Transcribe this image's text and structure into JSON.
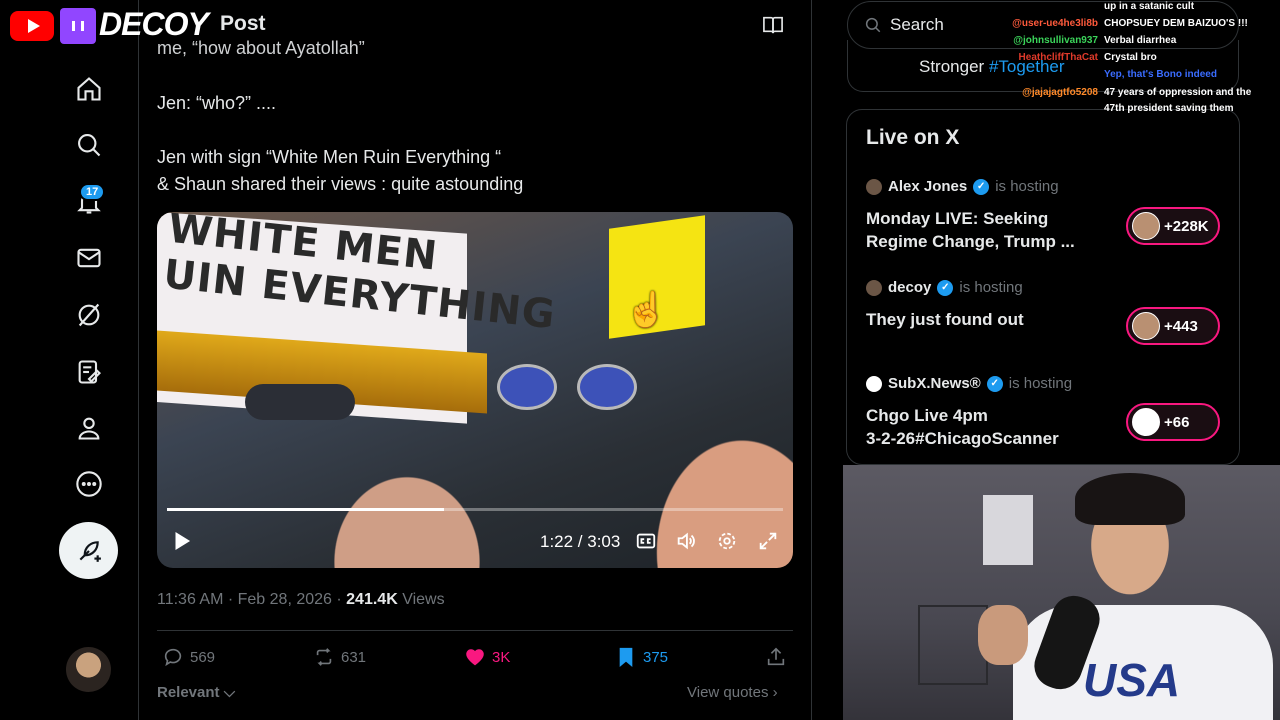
{
  "header": {
    "brand": "DECOY",
    "page_title": "Post"
  },
  "nav": {
    "notifications_badge": "17"
  },
  "tweet": {
    "lines": [
      "me, “how about Ayatollah”",
      "Jen: “who?” ....",
      "Jen with sign “White Men Ruin Everything “",
      "& Shaun shared their views :  quite astounding"
    ],
    "video": {
      "sign_text_line1": "WHITE MEN",
      "sign_text_line2": "UIN EVERYTHING",
      "time_display": "1:22 / 3:03",
      "progress": 0.45
    },
    "timestamp": "11:36 AM · Feb 28, 2026 · ",
    "views_count": "241.4K",
    "views_label": " Views",
    "replies": "569",
    "reposts": "631",
    "likes": "3K",
    "bookmarks": "375",
    "sort_label": "Relevant",
    "view_quotes": "View quotes"
  },
  "search": {
    "placeholder": "Search"
  },
  "trend": {
    "text_prefix": "Stronger ",
    "hashtag": "#Together"
  },
  "live": {
    "title": "Live on X",
    "spaces": [
      {
        "host": "Alex Jones",
        "status": "is hosting",
        "title_line1": "Monday LIVE: Seeking",
        "title_line2": "Regime Change, Trump ...",
        "listeners": "+228K"
      },
      {
        "host": "decoy",
        "status": "is hosting",
        "title_line1": "They just found out",
        "title_line2": "",
        "listeners": "+443"
      },
      {
        "host": "SubX.News®",
        "status": "is hosting",
        "title_line1": "Chgo Live 4pm",
        "title_line2": "3-2-26#ChicagoScanner",
        "listeners": "+66"
      }
    ]
  },
  "chat": [
    {
      "user": "",
      "message": "up in a satanic cult",
      "color": "#ffffff"
    },
    {
      "user": "@user-ue4he3li8b",
      "message": "CHOPSUEY DEM BAIZUO'S !!!",
      "color": "#ff5a3c"
    },
    {
      "user": "@johnsullivan937",
      "message": "Verbal diarrhea",
      "color": "#3bd45a"
    },
    {
      "user": "HeathcliffThaCat",
      "message": "Crystal bro",
      "color": "#e03a2a"
    },
    {
      "user": "",
      "message": "Yep, that's Bono indeed",
      "color": "#3a6cff"
    },
    {
      "user": "@jajajagtfo5208",
      "message": "47 years of oppression and the",
      "color": "#ff8a2a"
    },
    {
      "user": "",
      "message": "47th president saving them",
      "color": "#ffffff"
    }
  ],
  "colors": {
    "accent": "#1d9bf0",
    "like": "#f91880",
    "live_border": "#f91880"
  }
}
